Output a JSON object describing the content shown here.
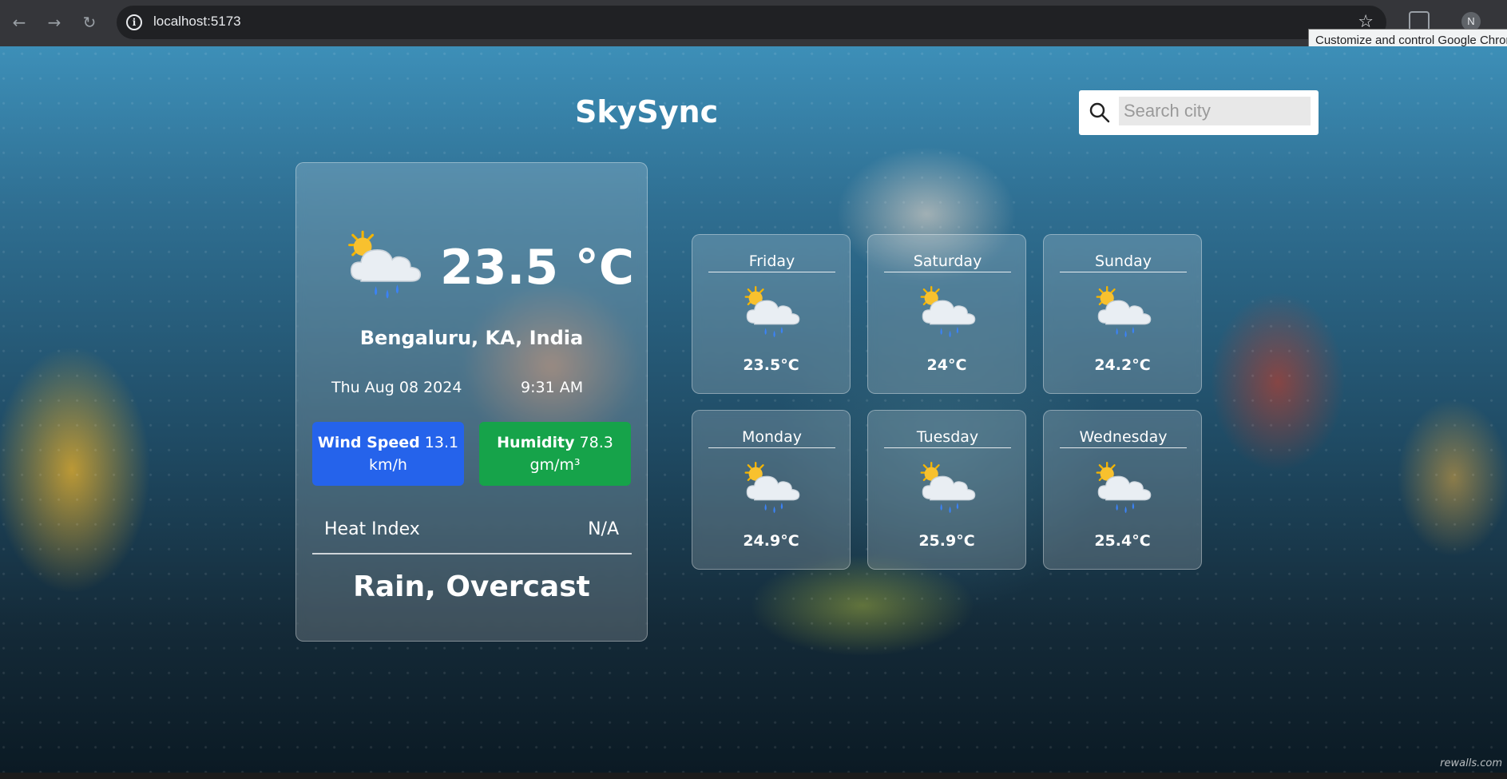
{
  "browser": {
    "url": "localhost:5173",
    "profile_initial": "N",
    "tooltip": "Customize and control Google Chrome"
  },
  "app": {
    "brand": "SkySync",
    "search": {
      "placeholder": "Search city",
      "value": ""
    }
  },
  "current": {
    "temperature": "23.5 °C",
    "location": "Bengaluru, KA, India",
    "date": "Thu Aug 08 2024",
    "time": "9:31 AM",
    "wind_label": "Wind Speed",
    "wind_value": "13.1 km/h",
    "humidity_label": "Humidity",
    "humidity_value": "78.3 gm/m³",
    "heat_index_label": "Heat Index",
    "heat_index_value": "N/A",
    "condition": "Rain, Overcast",
    "icon": "sun-cloud-rain-icon"
  },
  "forecast": [
    {
      "day": "Friday",
      "temp": "23.5°C",
      "icon": "sun-cloud-rain-icon"
    },
    {
      "day": "Saturday",
      "temp": "24°C",
      "icon": "sun-cloud-rain-icon"
    },
    {
      "day": "Sunday",
      "temp": "24.2°C",
      "icon": "sun-cloud-rain-icon"
    },
    {
      "day": "Monday",
      "temp": "24.9°C",
      "icon": "sun-cloud-rain-icon"
    },
    {
      "day": "Tuesday",
      "temp": "25.9°C",
      "icon": "sun-cloud-rain-icon"
    },
    {
      "day": "Wednesday",
      "temp": "25.4°C",
      "icon": "sun-cloud-rain-icon"
    }
  ],
  "watermark": "rewalls.com",
  "colors": {
    "wind_pill": "#2563eb",
    "humidity_pill": "#16a34a"
  }
}
